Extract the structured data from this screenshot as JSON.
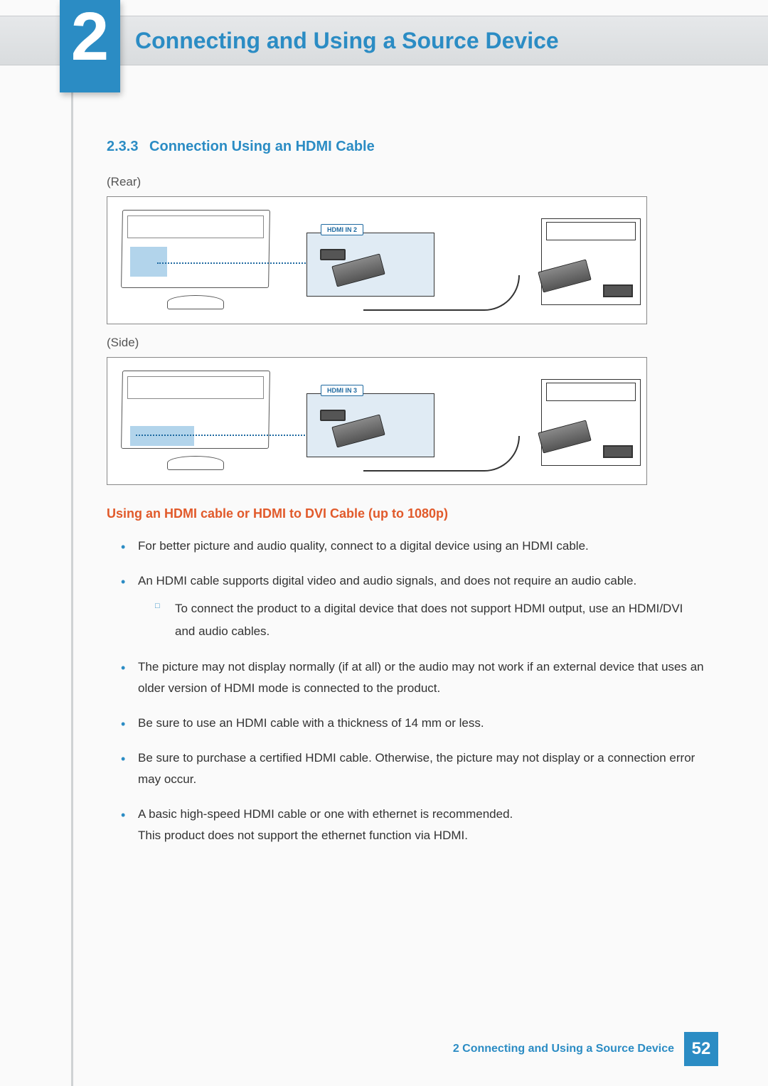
{
  "chapter": {
    "number": "2",
    "title": "Connecting and Using a Source Device"
  },
  "section": {
    "number": "2.3.3",
    "title": "Connection Using an HDMI Cable"
  },
  "diagrams": {
    "rear": {
      "caption": "(Rear)",
      "port_label": "HDMI IN 2"
    },
    "side": {
      "caption": "(Side)",
      "port_label": "HDMI IN 3"
    }
  },
  "subheading": "Using an HDMI cable or HDMI to DVI Cable (up to 1080p)",
  "bullets": [
    {
      "text": "For better picture and audio quality, connect to a digital device using an HDMI cable."
    },
    {
      "text": "An HDMI cable supports digital video and audio signals, and does not require an audio cable.",
      "sub": [
        "To connect the product to a digital device that does not support HDMI output, use an HDMI/DVI and audio cables."
      ]
    },
    {
      "text": "The picture may not display normally (if at all) or the audio may not work if an external device that uses an older version of HDMI mode is connected to the product."
    },
    {
      "text": "Be sure to use an HDMI cable with a thickness of 14 mm or less."
    },
    {
      "text": "Be sure to purchase a certified HDMI cable. Otherwise, the picture may not display or a connection error may occur."
    },
    {
      "text": "A basic high-speed HDMI cable or one with ethernet is recommended.\nThis product does not support the ethernet function via HDMI."
    }
  ],
  "footer": {
    "text": "2 Connecting and Using a Source Device",
    "page": "52"
  }
}
